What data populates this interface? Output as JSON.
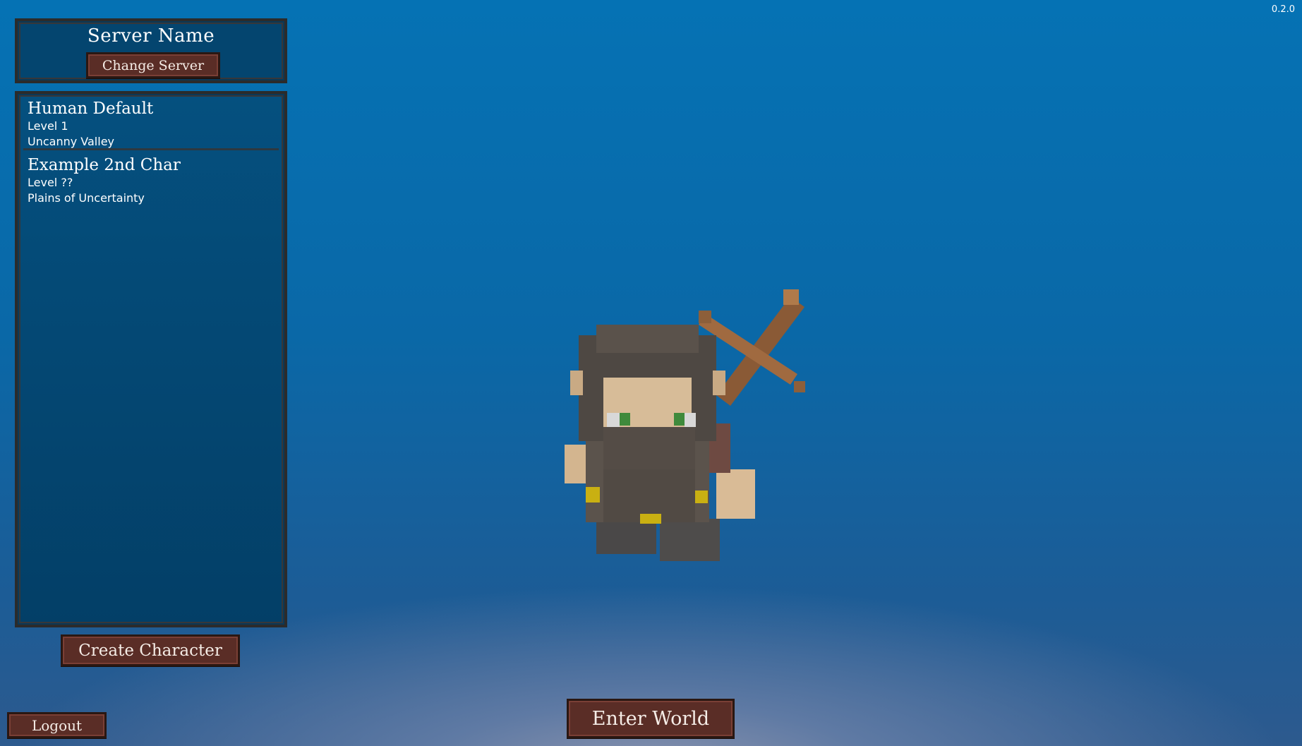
{
  "version": "0.2.0",
  "server": {
    "name": "Server Name",
    "change_label": "Change Server"
  },
  "characters": [
    {
      "name": "Human Default",
      "level": "Level 1",
      "location": "Uncanny Valley",
      "selected": true
    },
    {
      "name": "Example 2nd Char",
      "level": "Level ??",
      "location": "Plains of Uncertainty",
      "selected": false
    }
  ],
  "buttons": {
    "create": "Create Character",
    "logout": "Logout",
    "enter": "Enter World"
  },
  "preview": {
    "icon": "voxel-dwarf-character",
    "weapon_icon": "crossbow-icon"
  },
  "colors": {
    "background": "#0572b4",
    "panel": "#04456f",
    "button": "#5a2d26",
    "frame": "#2b2b2b"
  }
}
